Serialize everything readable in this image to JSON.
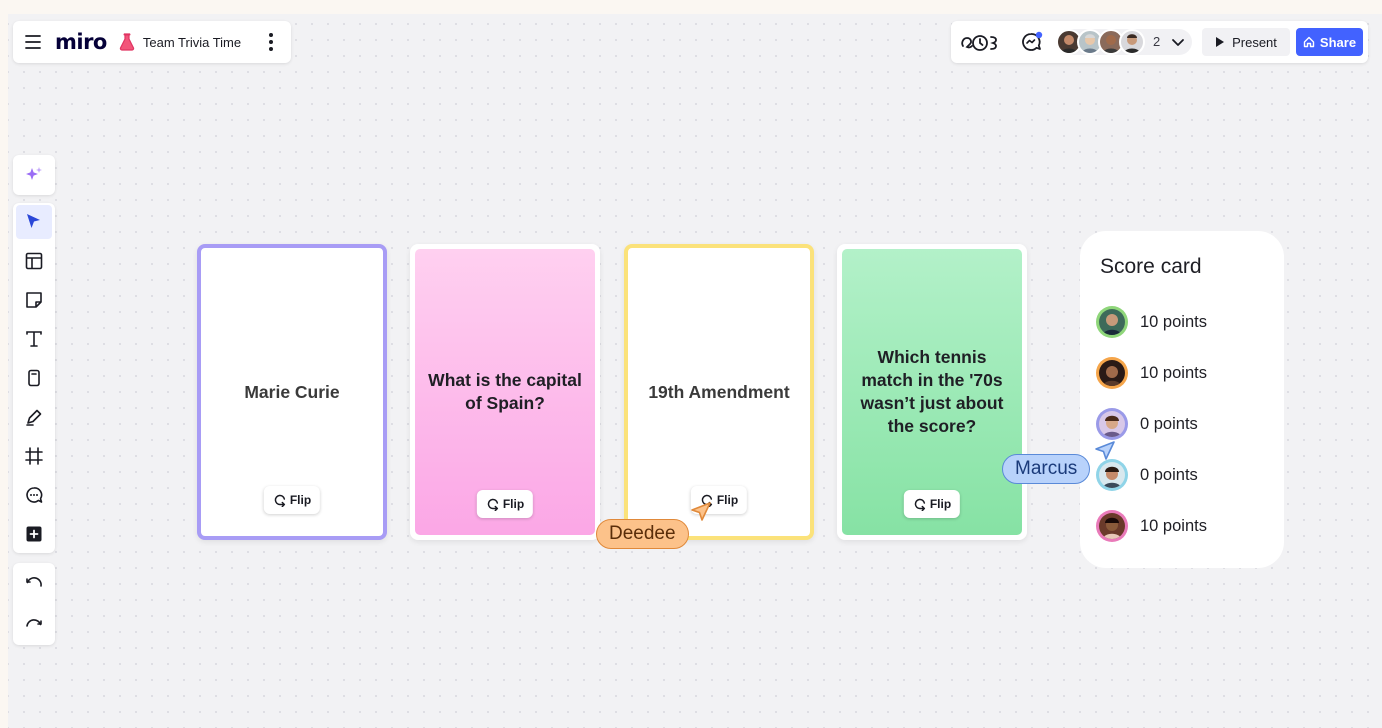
{
  "app": {
    "logo": "miro",
    "board_title": "Team Trivia Time"
  },
  "collaboration": {
    "avatar_count": "2",
    "present_label": "Present",
    "share_label": "Share"
  },
  "toolbar": {
    "tools": [
      {
        "name": "ai-sparkle-icon"
      },
      {
        "name": "select-cursor-icon",
        "active": true
      },
      {
        "name": "templates-icon"
      },
      {
        "name": "sticky-note-icon"
      },
      {
        "name": "text-icon"
      },
      {
        "name": "card-icon"
      },
      {
        "name": "pen-icon"
      },
      {
        "name": "frame-icon"
      },
      {
        "name": "comment-icon"
      },
      {
        "name": "add-more-icon"
      },
      {
        "name": "undo-icon"
      },
      {
        "name": "redo-icon"
      }
    ]
  },
  "cards": [
    {
      "text": "Marie Curie",
      "flip_label": "Flip",
      "style": "answer",
      "border": "#a89cf5"
    },
    {
      "text": "What is the capital of Spain?",
      "flip_label": "Flip",
      "style": "question",
      "fill": "pink"
    },
    {
      "text": "19th Amendment",
      "flip_label": "Flip",
      "style": "answer",
      "border": "#fbe27a"
    },
    {
      "text": "Which tennis match in the '70s wasn’t just about the score?",
      "flip_label": "Flip",
      "style": "question",
      "fill": "green"
    }
  ],
  "score_card": {
    "title": "Score card",
    "rows": [
      {
        "points": "10 points",
        "ring": "#8fd67a"
      },
      {
        "points": "10 points",
        "ring": "#f5a54a"
      },
      {
        "points": "0 points",
        "ring": "#9a9ae8"
      },
      {
        "points": "0 points",
        "ring": "#8fd4e8"
      },
      {
        "points": "10 points",
        "ring": "#e97ab9"
      }
    ]
  },
  "cursors": [
    {
      "name": "Deedee",
      "color": "#fcc28a",
      "border": "#e0893a",
      "text_color": "#5a2e0a"
    },
    {
      "name": "Marcus",
      "color": "#b8d2fb",
      "border": "#5a8ad8",
      "text_color": "#1a3a7a"
    }
  ],
  "colors": {
    "accent": "#4262ff",
    "canvas": "#f2f2f4"
  }
}
